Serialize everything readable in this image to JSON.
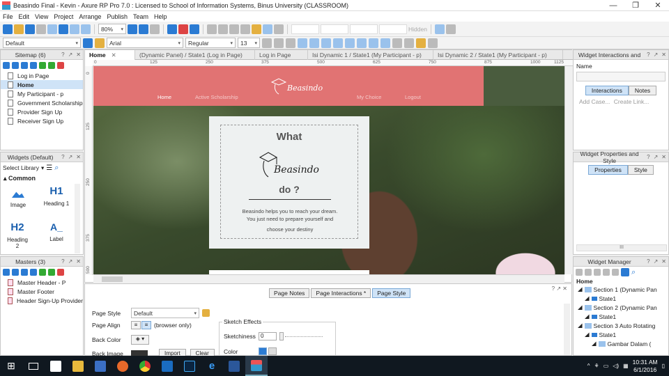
{
  "window": {
    "title": "Beasindo Final - Kevin - Axure RP Pro 7.0 : Licensed to School of Information Systems, Binus University (CLASSROOM)",
    "minimize": "—",
    "restore": "❐",
    "close": "✕"
  },
  "menu": [
    "File",
    "Edit",
    "View",
    "Project",
    "Arrange",
    "Publish",
    "Team",
    "Help"
  ],
  "toolbar": {
    "zoom": "80%",
    "style_select": "Default",
    "font": "Arial",
    "font_style": "Regular",
    "font_size": "13",
    "hidden_label": "Hidden"
  },
  "sitemap": {
    "title": "Sitemap (6)",
    "items": [
      "Log in Page",
      "Home",
      "My Participant - p",
      "Government Scholarship",
      "Provider Sign Up",
      "Receiver Sign Up"
    ],
    "selected": "Home"
  },
  "widgets": {
    "title": "Widgets (Default)",
    "select_library": "Select Library",
    "section": "Common",
    "items": [
      {
        "glyph": "",
        "label": "Image"
      },
      {
        "glyph": "H1",
        "label": "Heading 1"
      },
      {
        "glyph": "H2",
        "label": "Heading 2"
      },
      {
        "glyph": "A_",
        "label": "Label"
      }
    ]
  },
  "masters": {
    "title": "Masters (3)",
    "items": [
      "Master Header - P",
      "Master Footer",
      "Header Sign-Up Provider"
    ]
  },
  "tabs": [
    {
      "label": "Home",
      "active": true
    },
    {
      "label": "(Dynamic Panel) / State1 (Log in Page)"
    },
    {
      "label": "Log in Page"
    },
    {
      "label": "Isi Dynamic 1 / State1 (My Participant - p)"
    },
    {
      "label": "Isi Dynamic 2 / State1 (My Participant - p)"
    }
  ],
  "ruler": {
    "top": [
      "0",
      "125",
      "250",
      "375",
      "500",
      "625",
      "750",
      "875",
      "1000",
      "1125"
    ],
    "left": [
      "0",
      "125",
      "250",
      "375",
      "500"
    ]
  },
  "design": {
    "nav": [
      "Home",
      "Active Scholarship",
      "My Choice",
      "Logout"
    ],
    "brand": "Beasindo",
    "popup_what": "What",
    "popup_do": "do ?",
    "popup_desc": [
      "Beasindo helps you to reach your dream.",
      "You just need to prepare yourself and",
      "choose your destiny"
    ]
  },
  "bottom": {
    "tabs": [
      "Page Notes",
      "Page Interactions *",
      "Page Style"
    ],
    "active_tab": "Page Style",
    "page_style_label": "Page Style",
    "page_style_value": "Default",
    "page_align_label": "Page Align",
    "browser_only": "(browser only)",
    "back_color_label": "Back Color",
    "back_image_label": "Back Image",
    "import": "Import",
    "clear": "Clear",
    "sketch_effects": "Sketch Effects",
    "sketchiness_label": "Sketchiness",
    "sketchiness_value": "0",
    "color_label": "Color"
  },
  "interactions_panel": {
    "title": "Widget Interactions and",
    "name_label": "Name",
    "tab_interactions": "Interactions",
    "tab_notes": "Notes",
    "add_case": "Add Case...",
    "create_link": "Create Link..."
  },
  "properties_panel": {
    "title": "Widget Properties and Style",
    "tab_properties": "Properties",
    "tab_style": "Style",
    "scroll_label": "III"
  },
  "widget_manager": {
    "title": "Widget Manager",
    "root": "Home",
    "items": [
      "Section 1 (Dynamic Pan",
      "State1",
      "Section 2 (Dynamic Pan",
      "State1",
      "Section 3 Auto Rotating",
      "State1",
      "Gambar Dalam ("
    ]
  },
  "taskbar": {
    "time": "10:31 AM",
    "date": "6/1/2016"
  },
  "colors": {
    "banner": "#e17373",
    "accent_blue": "#2b7bd3",
    "selection": "#cfe3f7"
  }
}
